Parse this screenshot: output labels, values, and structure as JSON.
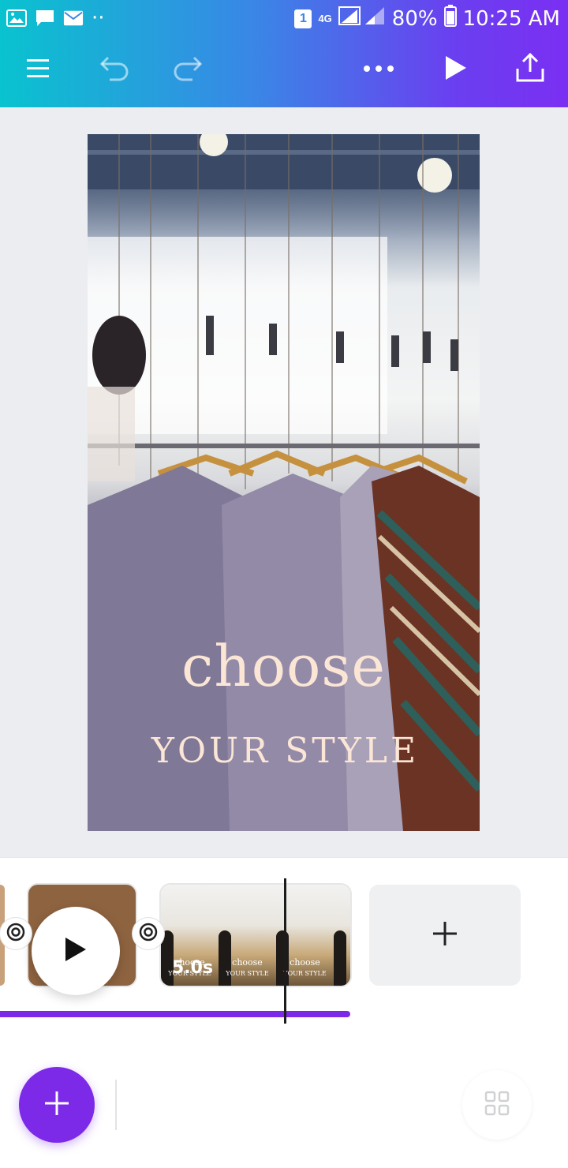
{
  "status_bar": {
    "sim_badge": "1",
    "network": "4G",
    "battery": "80%",
    "time": "10:25 AM",
    "notification_dots": "··"
  },
  "toolbar": {
    "menu_icon": "hamburger-icon",
    "undo_icon": "undo-icon",
    "redo_icon": "redo-icon",
    "more_icon": "more-horizontal-icon",
    "play_icon": "play-icon",
    "share_icon": "upload-icon"
  },
  "design": {
    "headline_line1": "choose",
    "headline_line2": "YOUR STYLE"
  },
  "timeline": {
    "clip_duration": "5.0s",
    "thumb_text_1": "choose",
    "thumb_text_2": "YOUR STYLE",
    "add_page_label": "+"
  },
  "bottom_bar": {
    "add_label": "+"
  },
  "colors": {
    "accent": "#7d2ae8",
    "header_gradient_start": "#09c3cf",
    "header_gradient_end": "#7b2ff2",
    "canvas_bg": "#ebedf1",
    "headline_text": "#fbe6d6"
  }
}
